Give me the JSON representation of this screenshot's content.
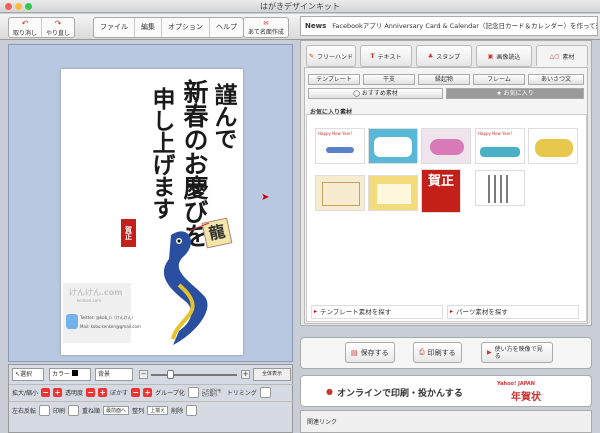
{
  "window": {
    "title": "はがきデザインキット"
  },
  "toolbar": {
    "undo": "取り消し",
    "redo": "やり直し",
    "file": "ファイル",
    "edit": "編集",
    "options": "オプション",
    "help": "ヘルプ",
    "name_entry": "あて名面作成"
  },
  "news": {
    "label": "News",
    "text": "Facebookアプリ Anniversary Card & Calendar（記念日カード＆カレンダー）を作って送ろう"
  },
  "card": {
    "line1": "謹んで",
    "line2": "新春のお慶びを",
    "line3": "申し上げます",
    "stamp": "賀正",
    "kite": "龍",
    "brand": "けんけん.com",
    "twitter": "Twitter: @kob_n（けんけん）",
    "mail": "Mail: kobo.kenken@gmail.com",
    "url": "kenken.com"
  },
  "tabs": {
    "freehand": "フリーハンド",
    "text": "テキスト",
    "stamp": "スタンプ",
    "image": "画像読込",
    "material": "素材"
  },
  "subtabs": {
    "template": "テンプレート",
    "greeting": "干支",
    "lucky": "縁起物",
    "frame": "フレーム",
    "aisatsu": "あいさつ文",
    "recommended": "おすすめ素材",
    "favorites": "お気に入り"
  },
  "favorites": {
    "heading": "お気に入り素材",
    "thumb_text": "Happy New Year!",
    "stamp_text": "賀正"
  },
  "search": {
    "template": "テンプレート素材を探す",
    "parts": "パーツ素材を探す"
  },
  "actions": {
    "save": "保存する",
    "print": "印刷する",
    "video": "使い方を映像で見る",
    "online": "オンラインで印刷・投かんする",
    "yahoo_brand": "Yahoo! JAPAN",
    "yahoo_text": "年賀状"
  },
  "bottom": {
    "select": "選択",
    "color": "カラー",
    "background": "背景",
    "zoom_label": "全体表示",
    "scale": "拡大/縮小",
    "opacity": "透明度",
    "blur": "ぼかす",
    "group": "グループ化",
    "trim": "トリミング",
    "flip": "左右反転",
    "print_label": "印刷",
    "order": "重ね順",
    "front": "最前面へ",
    "align": "整列",
    "top": "上揃え",
    "delete": "削除",
    "cut_label": "この部分を切り取り"
  },
  "related": {
    "label": "関連リンク"
  }
}
